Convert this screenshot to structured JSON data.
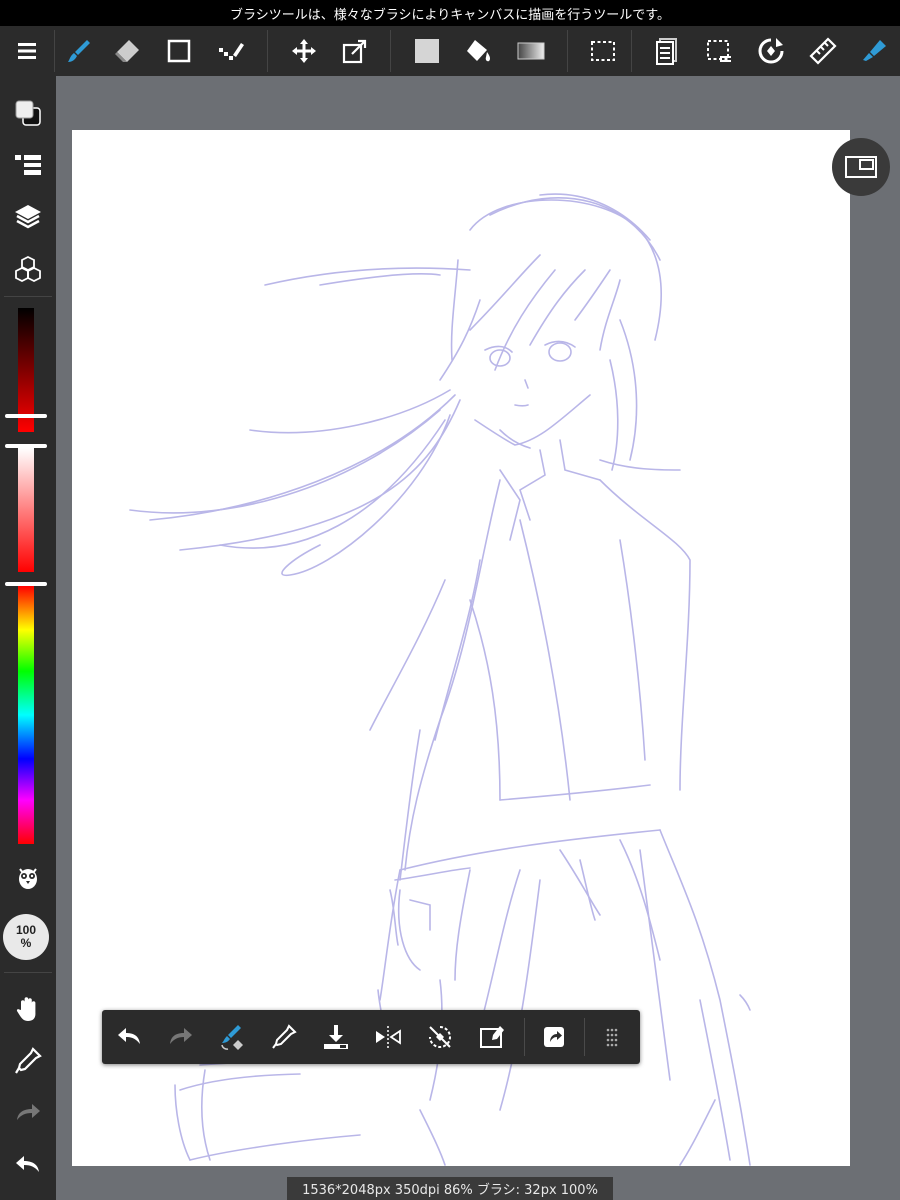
{
  "status_bar": {
    "hint": "ブラシツールは、様々なブラシによりキャンバスに描画を行うツールです。"
  },
  "toolbar": {
    "items": [
      "menu",
      "brush",
      "eraser",
      "shape",
      "dot",
      "move",
      "transform",
      "fill-color",
      "bucket",
      "gradient",
      "select-rect",
      "layers-copy",
      "select-tool",
      "rotate",
      "ruler",
      "auto-brush"
    ],
    "accent": "#2f9bd6"
  },
  "sidebar": {
    "zoom": {
      "value": "100",
      "unit": "%"
    },
    "color_sliders": {
      "brightness_pct": 0.86,
      "saturation_pct": 0.02,
      "hue_pct": 0.0
    }
  },
  "canvas": {
    "stroke_color": "#b9b6e8",
    "background": "#ffffff",
    "workspace_color": "#6c6f74"
  },
  "quick_bar": {
    "items": [
      "undo",
      "redo",
      "brush-eraser-toggle",
      "eyedropper",
      "import",
      "flip",
      "rotate-reset",
      "clear",
      "share",
      "more"
    ]
  },
  "info_bar": {
    "text": "1536*2048px 350dpi 86% ブラシ: 32px 100%"
  }
}
